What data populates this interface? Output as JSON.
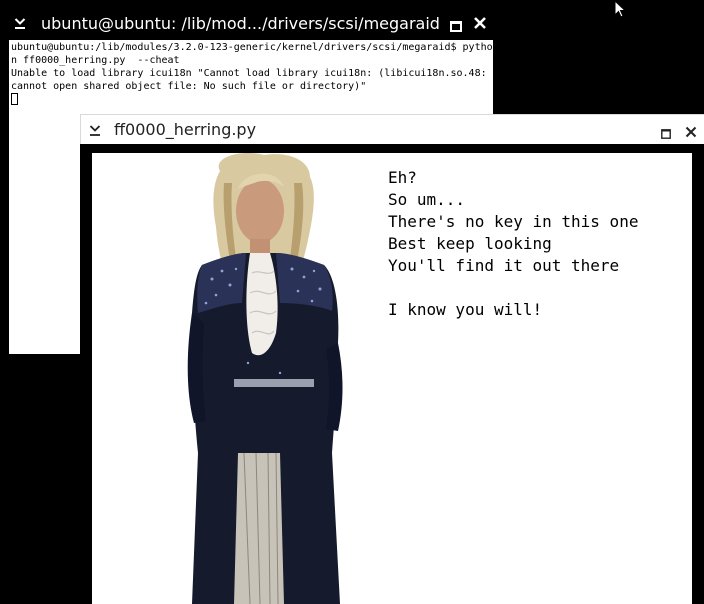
{
  "terminal": {
    "title": "ubuntu@ubuntu: /lib/mod.../drivers/scsi/megaraid",
    "lines": [
      "ubuntu@ubuntu:/lib/modules/3.2.0-123-generic/kernel/drivers/scsi/megaraid$ pytho",
      "n ff0000_herring.py  --cheat",
      "Unable to load library icui18n \"Cannot load library icui18n: (libicui18n.so.48:",
      "cannot open shared object file: No such file or directory)\""
    ]
  },
  "app_window": {
    "title": "ff0000_herring.py",
    "message_lines": [
      "Eh?",
      "So um...",
      "There's no key in this one",
      "Best keep looking",
      "You'll find it out there",
      "",
      "I know you will!"
    ]
  },
  "icons": {
    "minimize": "chevron-down-icon",
    "maximize": "maximize-icon",
    "close": "close-icon",
    "pointer": "mouse-pointer-icon"
  }
}
